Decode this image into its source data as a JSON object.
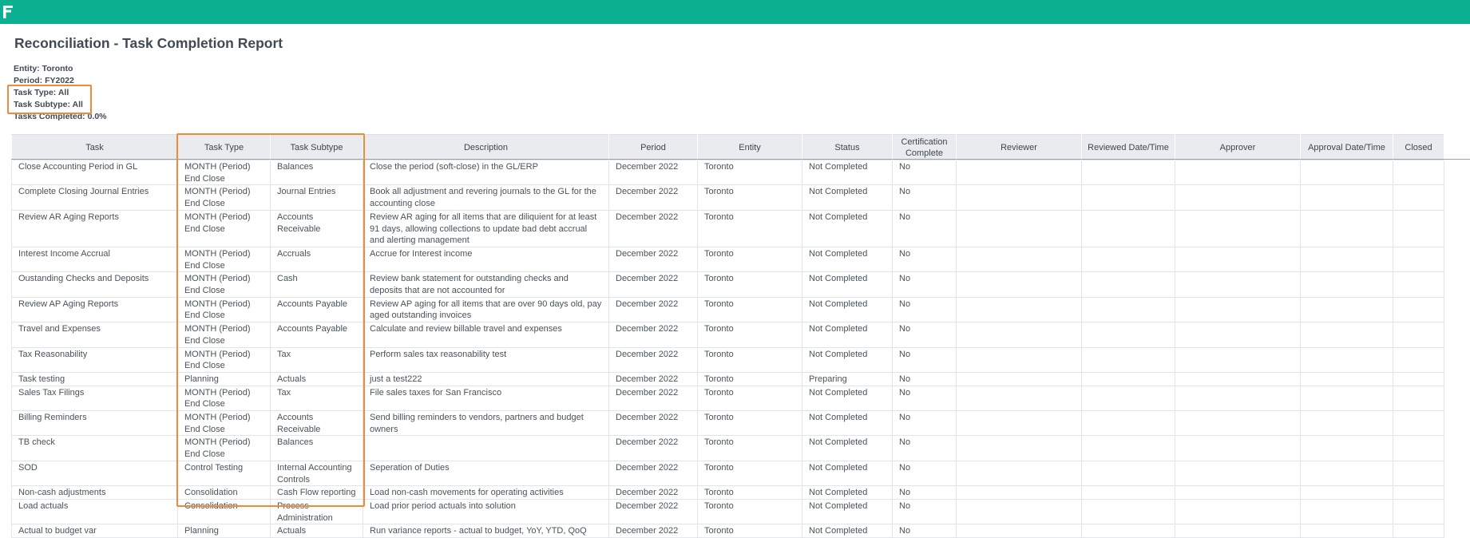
{
  "header": {
    "brand_color": "#0ab08f",
    "logo_icon": "logo-icon"
  },
  "report": {
    "title": "Reconciliation - Task Completion Report",
    "entity": "Entity: Toronto",
    "period": "Period: FY2022",
    "task_type": "Task Type: All",
    "task_subtype": "Task Subtype: All",
    "tasks_completed": "Tasks Completed: 0.0%"
  },
  "highlight_color": "#f08a3a",
  "table": {
    "columns": [
      "Task",
      "Task Type",
      "Task Subtype",
      "Description",
      "Period",
      "Entity",
      "Status",
      "Certification Complete",
      "Reviewer",
      "Reviewed Date/Time",
      "Approver",
      "Approval Date/Time",
      "Closed"
    ],
    "rows": [
      [
        "Close Accounting Period in GL",
        "MONTH (Period) End Close",
        "Balances",
        "Close the period (soft-close) in the GL/ERP",
        "December 2022",
        "Toronto",
        "Not Completed",
        "No",
        "",
        "",
        "",
        "",
        ""
      ],
      [
        "Complete Closing Journal Entries",
        "MONTH (Period) End Close",
        "Journal Entries",
        "Book all adjustment and revering journals to the GL for the accounting close",
        "December 2022",
        "Toronto",
        "Not Completed",
        "No",
        "",
        "",
        "",
        "",
        ""
      ],
      [
        "Review AR Aging Reports",
        "MONTH (Period) End Close",
        "Accounts Receivable",
        "Review AR aging for all items that are diliquient for at least 91 days, allowing collections to update bad debt accrual and alerting management",
        "December 2022",
        "Toronto",
        "Not Completed",
        "No",
        "",
        "",
        "",
        "",
        ""
      ],
      [
        "Interest Income Accrual",
        "MONTH (Period) End Close",
        "Accruals",
        "Accrue for Interest income",
        "December 2022",
        "Toronto",
        "Not Completed",
        "No",
        "",
        "",
        "",
        "",
        ""
      ],
      [
        "Oustanding Checks and Deposits",
        "MONTH (Period) End Close",
        "Cash",
        "Review bank statement for outstanding checks and deposits that are not accounted for",
        "December 2022",
        "Toronto",
        "Not Completed",
        "No",
        "",
        "",
        "",
        "",
        ""
      ],
      [
        "Review AP Aging Reports",
        "MONTH (Period) End Close",
        "Accounts Payable",
        "Review AP aging for all items that are over 90 days old, pay aged outstanding invoices",
        "December 2022",
        "Toronto",
        "Not Completed",
        "No",
        "",
        "",
        "",
        "",
        ""
      ],
      [
        "Travel and Expenses",
        "MONTH (Period) End Close",
        "Accounts Payable",
        "Calculate and review billable travel and expenses",
        "December 2022",
        "Toronto",
        "Not Completed",
        "No",
        "",
        "",
        "",
        "",
        ""
      ],
      [
        "Tax Reasonability",
        "MONTH (Period) End Close",
        "Tax",
        "Perform sales tax reasonability test",
        "December 2022",
        "Toronto",
        "Not Completed",
        "No",
        "",
        "",
        "",
        "",
        ""
      ],
      [
        "Task testing",
        "Planning",
        "Actuals",
        "just a test222",
        "December 2022",
        "Toronto",
        "Preparing",
        "No",
        "",
        "",
        "",
        "",
        ""
      ],
      [
        "Sales Tax Filings",
        "MONTH (Period) End Close",
        "Tax",
        "File sales taxes for San Francisco",
        "December 2022",
        "Toronto",
        "Not Completed",
        "No",
        "",
        "",
        "",
        "",
        ""
      ],
      [
        "Billing Reminders",
        "MONTH (Period) End Close",
        "Accounts Receivable",
        "Send billing reminders to vendors, partners and budget owners",
        "December 2022",
        "Toronto",
        "Not Completed",
        "No",
        "",
        "",
        "",
        "",
        ""
      ],
      [
        "TB check",
        "MONTH (Period) End Close",
        "Balances",
        "",
        "December 2022",
        "Toronto",
        "Not Completed",
        "No",
        "",
        "",
        "",
        "",
        ""
      ],
      [
        "SOD",
        "Control Testing",
        "Internal Accounting Controls",
        "Seperation of Duties",
        "December 2022",
        "Toronto",
        "Not Completed",
        "No",
        "",
        "",
        "",
        "",
        ""
      ],
      [
        "Non-cash adjustments",
        "Consolidation",
        "Cash Flow reporting",
        "Load non-cash movements for operating activities",
        "December 2022",
        "Toronto",
        "Not Completed",
        "No",
        "",
        "",
        "",
        "",
        ""
      ],
      [
        "Load actuals",
        "Consolidation",
        "Process Administration",
        "Load prior period actuals into solution",
        "December 2022",
        "Toronto",
        "Not Completed",
        "No",
        "",
        "",
        "",
        "",
        ""
      ],
      [
        "Actual to budget var",
        "Planning",
        "Actuals",
        "Run variance reports - actual to budget, YoY, YTD, QoQ",
        "December 2022",
        "Toronto",
        "Not Completed",
        "No",
        "",
        "",
        "",
        "",
        ""
      ]
    ]
  }
}
